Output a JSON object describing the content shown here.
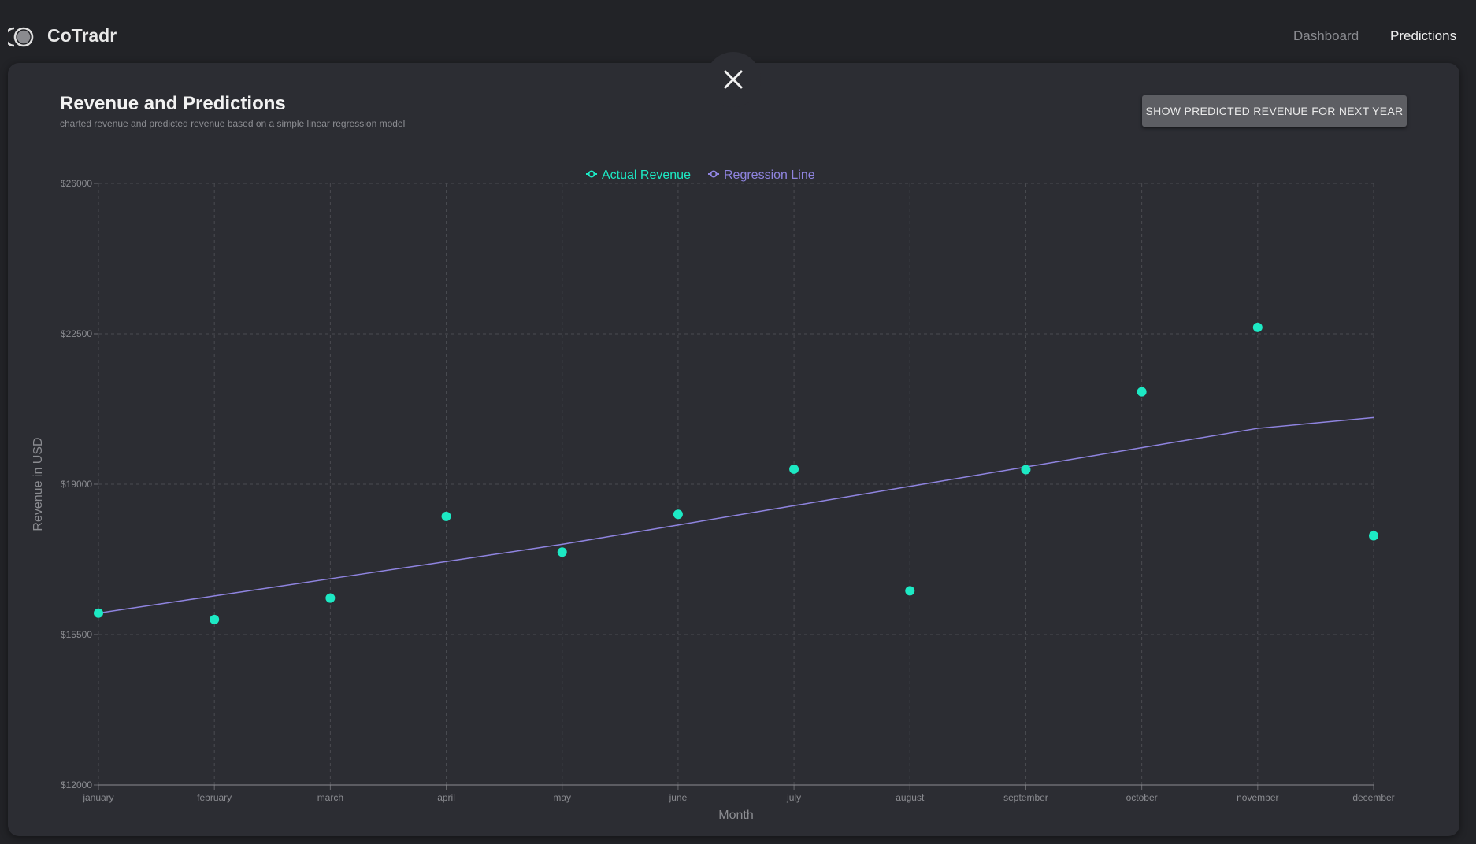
{
  "app": {
    "brand": "CoTradr",
    "nav": [
      {
        "label": "Dashboard",
        "active": false
      },
      {
        "label": "Predictions",
        "active": true
      }
    ]
  },
  "panel": {
    "title": "Revenue and Predictions",
    "subtitle": "charted revenue and predicted revenue based on a simple linear regression model",
    "predict_button_label": "SHOW PREDICTED REVENUE FOR NEXT YEAR",
    "close_icon": "close-icon"
  },
  "colors": {
    "background": "#222327",
    "card": "#2c2d33",
    "actual": "#1de9c4",
    "regression": "#8f84e0",
    "grid": "#4a4b51",
    "axis_text": "#8b8c91"
  },
  "chart_data": {
    "type": "scatter",
    "xlabel": "Month",
    "ylabel": "Revenue in USD",
    "categories": [
      "january",
      "february",
      "march",
      "april",
      "may",
      "june",
      "july",
      "august",
      "september",
      "october",
      "november",
      "december"
    ],
    "yticks": [
      "$12000",
      "$15500",
      "$19000",
      "$22500",
      "$26000"
    ],
    "ytick_values": [
      12000,
      15500,
      19000,
      22500,
      26000
    ],
    "ylim": [
      12000,
      26000
    ],
    "grid": true,
    "legend_position": "top-center",
    "series": [
      {
        "name": "Actual Revenue",
        "kind": "points",
        "values": [
          16000,
          15850,
          16350,
          18250,
          17420,
          18300,
          19350,
          16520,
          19340,
          21150,
          22650,
          17800
        ]
      },
      {
        "name": "Regression Line",
        "kind": "line",
        "values": [
          16000,
          16400,
          16800,
          17200,
          17600,
          18050,
          18500,
          18950,
          19400,
          19850,
          20300,
          20550
        ]
      }
    ]
  }
}
